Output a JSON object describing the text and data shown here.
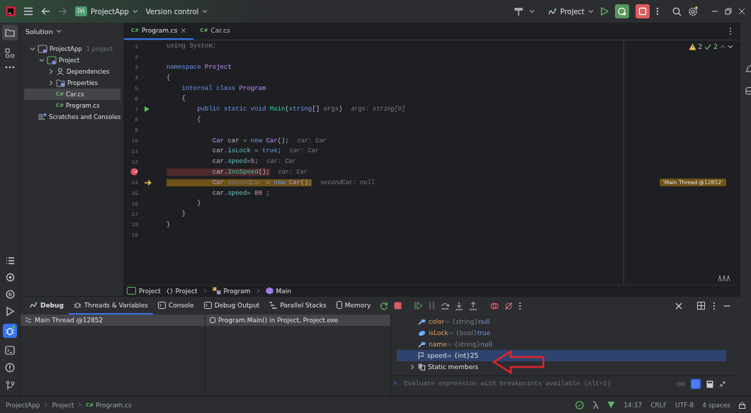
{
  "title_bar": {
    "project_badge": "PA",
    "project": "ProjectApp",
    "vcs": "Version control",
    "run_config": "Project"
  },
  "solution_panel": {
    "title": "Solution",
    "tree": [
      {
        "label": "ProjectApp",
        "kind": "solution",
        "note": "1 project",
        "expanded": true,
        "selected": false,
        "children": [
          {
            "label": "Project",
            "kind": "project",
            "expanded": true,
            "selected": false,
            "children": [
              {
                "label": "Dependencies",
                "kind": "dependencies",
                "expanded": false,
                "selected": false
              },
              {
                "label": "Properties",
                "kind": "properties",
                "expanded": false,
                "selected": false
              },
              {
                "label": "Car.cs",
                "kind": "file",
                "badge": "C#",
                "selected": true
              },
              {
                "label": "Program.cs",
                "kind": "file",
                "badge": "C#",
                "selected": false
              }
            ]
          }
        ]
      },
      {
        "label": "Scratches and Consoles",
        "kind": "scratches",
        "selected": false
      }
    ]
  },
  "editor": {
    "tabs": [
      {
        "label": "Program.cs",
        "badge": "C#",
        "selected": true
      },
      {
        "label": "Car.cs",
        "badge": "C#",
        "selected": false
      }
    ],
    "inspections": {
      "warnings": "2",
      "ok": "2"
    },
    "lines": [
      {
        "number": "1",
        "kind": "code",
        "tokens": [
          {
            "text": "using System;",
            "kind": "dim"
          }
        ]
      },
      {
        "number": "2",
        "kind": "code"
      },
      {
        "number": "3",
        "kind": "code",
        "tokens": [
          {
            "text": "namespace",
            "kind": "keyword"
          },
          {
            "text": " Project",
            "kind": "type"
          }
        ]
      },
      {
        "number": "4",
        "kind": "code",
        "tokens": [
          {
            "text": "{",
            "kind": "plain"
          }
        ]
      },
      {
        "number": "5",
        "kind": "code",
        "tokens": [
          {
            "text": "    internal class",
            "kind": "keyword"
          },
          {
            "text": " Program",
            "kind": "type"
          }
        ]
      },
      {
        "number": "6",
        "kind": "code",
        "tokens": [
          {
            "text": "    {",
            "kind": "plain"
          }
        ]
      },
      {
        "number": "7",
        "kind": "run",
        "tokens": [
          {
            "text": "        public static void",
            "kind": "keyword"
          },
          {
            "text": " Main",
            "kind": "method"
          },
          {
            "text": "(",
            "kind": "plain"
          },
          {
            "text": "string",
            "kind": "keyword"
          },
          {
            "text": "[] ",
            "kind": "plain"
          },
          {
            "text": "args",
            "kind": "dim"
          },
          {
            "text": ")",
            "kind": "plain"
          }
        ],
        "hint": "args: string[0]"
      },
      {
        "number": "8",
        "kind": "code",
        "tokens": [
          {
            "text": "        {",
            "kind": "plain"
          }
        ]
      },
      {
        "number": "9",
        "kind": "code"
      },
      {
        "number": "10",
        "kind": "code",
        "tokens": [
          {
            "text": "            Car",
            "kind": "type"
          },
          {
            "text": " car = ",
            "kind": "plain"
          },
          {
            "text": "new",
            "kind": "keyword"
          },
          {
            "text": " Car",
            "kind": "type"
          },
          {
            "text": "();",
            "kind": "plain"
          }
        ],
        "hint": "car: Car"
      },
      {
        "number": "11",
        "kind": "code",
        "tokens": [
          {
            "text": "            car.",
            "kind": "plain"
          },
          {
            "text": "isLock",
            "kind": "field"
          },
          {
            "text": " = ",
            "kind": "plain"
          },
          {
            "text": "true",
            "kind": "keyword"
          },
          {
            "text": ";",
            "kind": "plain"
          }
        ],
        "hint": "car: Car"
      },
      {
        "number": "12",
        "kind": "code",
        "tokens": [
          {
            "text": "            car.",
            "kind": "plain"
          },
          {
            "text": "speed",
            "kind": "field"
          },
          {
            "text": "=",
            "kind": "plain"
          },
          {
            "text": "5",
            "kind": "number"
          },
          {
            "text": ";",
            "kind": "plain"
          }
        ],
        "hint": "car: Car"
      },
      {
        "kind": "breakpoint",
        "tokens": [
          {
            "text": "            car.",
            "kind": "plain"
          },
          {
            "text": "IncSpeed",
            "kind": "method"
          },
          {
            "text": "();",
            "kind": "plain"
          }
        ],
        "hint": "car: Car"
      },
      {
        "number": "14",
        "kind": "execution",
        "tokens": [
          {
            "text": "            Car",
            "kind": "type"
          },
          {
            "text": " secondCar",
            "kind": "dim"
          },
          {
            "text": " = ",
            "kind": "plain"
          },
          {
            "text": "new",
            "kind": "keyword"
          },
          {
            "text": " Car",
            "kind": "type"
          },
          {
            "text": "();",
            "kind": "plain"
          }
        ],
        "hint": "secondCar: null",
        "thread_badge": "'Main Thread @12852'"
      },
      {
        "number": "15",
        "kind": "code",
        "tokens": [
          {
            "text": "            car.",
            "kind": "plain"
          },
          {
            "text": "speed",
            "kind": "field"
          },
          {
            "text": "= ",
            "kind": "plain"
          },
          {
            "text": "80",
            "kind": "number"
          },
          {
            "text": " ;",
            "kind": "plain"
          }
        ]
      },
      {
        "number": "16",
        "kind": "code",
        "tokens": [
          {
            "text": "        }",
            "kind": "plain"
          }
        ]
      },
      {
        "number": "17",
        "kind": "code",
        "tokens": [
          {
            "text": "    }",
            "kind": "plain"
          }
        ]
      },
      {
        "number": "18",
        "kind": "code",
        "tokens": [
          {
            "text": "}",
            "kind": "plain"
          }
        ]
      },
      {
        "number": "19",
        "kind": "code"
      }
    ],
    "breadcrumb": [
      {
        "label": "Project",
        "kind": "project"
      },
      {
        "label": "Project",
        "kind": "namespace"
      },
      {
        "label": "Program",
        "kind": "class"
      },
      {
        "label": "Main",
        "kind": "method"
      }
    ]
  },
  "debug": {
    "tabs": [
      {
        "label": "Debug",
        "kind": "title",
        "selected": false
      },
      {
        "label": "Threads & Variables",
        "kind": "threads",
        "selected": true
      },
      {
        "label": "Console",
        "kind": "console",
        "selected": false
      },
      {
        "label": "Debug Output",
        "kind": "output",
        "selected": false
      },
      {
        "label": "Parallel Stacks",
        "kind": "stacks",
        "selected": false
      },
      {
        "label": "Memory",
        "kind": "memory",
        "selected": false
      }
    ],
    "threads": [
      {
        "label": "Main Thread @12852",
        "selected": true
      }
    ],
    "frames": [
      {
        "label": "Program.Main() in Project, Project.exe",
        "selected": true
      }
    ],
    "variables": [
      {
        "kind": "property",
        "name": "color",
        "operator": "=",
        "type": "{string}",
        "value": "null",
        "selected": false
      },
      {
        "kind": "field",
        "name": "isLock",
        "operator": "=",
        "type": "{bool}",
        "value": "true",
        "selected": false
      },
      {
        "kind": "property",
        "name": "name",
        "operator": "=",
        "type": "{string}",
        "value": "null",
        "selected": false
      },
      {
        "kind": "flag",
        "name": "speed",
        "operator": "=",
        "type": "{int}",
        "value": "25",
        "selected": true
      },
      {
        "kind": "group",
        "name": "Static members",
        "expanded": false,
        "selected": false
      }
    ],
    "eval_prompt": ">",
    "eval_placeholder": "Evaluate expression with breakpoints available (Alt+I)"
  },
  "status_bar": {
    "path": [
      {
        "label": "ProjectApp"
      },
      {
        "label": "Project"
      },
      {
        "label": "Program.cs",
        "badge": "C#"
      }
    ],
    "items": [
      "14:17",
      "CRLF",
      "UTF-8",
      "4 spaces"
    ]
  }
}
